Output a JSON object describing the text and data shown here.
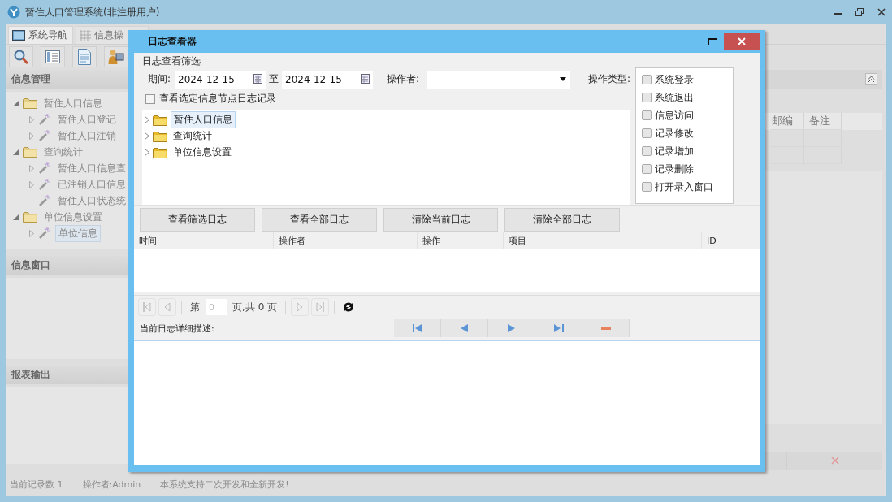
{
  "window": {
    "title": "暂住人口管理系统(非注册用户)"
  },
  "tabs": [
    {
      "label": "系统导航",
      "selected": true
    },
    {
      "label": "信息操",
      "selected": false
    }
  ],
  "sidebar": {
    "sections": [
      {
        "title": "信息管理",
        "tree": [
          {
            "label": "暂住人口信息",
            "expanded": true,
            "selected": false,
            "children": [
              {
                "label": "暂住人口登记",
                "expanded": false,
                "selected": false
              },
              {
                "label": "暂住人口注销",
                "expanded": false,
                "selected": false
              }
            ]
          },
          {
            "label": "查询统计",
            "expanded": true,
            "selected": false,
            "children": [
              {
                "label": "暂住人口信息查",
                "expanded": false,
                "selected": false
              },
              {
                "label": "已注销人口信息",
                "expanded": false,
                "selected": false
              },
              {
                "label": "暂住人口状态统",
                "selected": false
              }
            ]
          },
          {
            "label": "单位信息设置",
            "expanded": true,
            "selected": false,
            "children": [
              {
                "label": "单位信息",
                "expanded": false,
                "selected": true
              }
            ]
          }
        ]
      },
      {
        "title": "信息窗口"
      },
      {
        "title": "报表输出"
      }
    ]
  },
  "main_panel": {
    "columns": [
      "邮编",
      "备注"
    ]
  },
  "dialog": {
    "title": "日志查看器",
    "filter_title": "日志查看筛选",
    "period_label": "期间:",
    "date_from": "2024-12-15",
    "to_label": "至",
    "date_to": "2024-12-15",
    "operator_label": "操作者:",
    "type_label": "操作类型:",
    "types": [
      {
        "label": "系统登录",
        "checked": false
      },
      {
        "label": "系统退出",
        "checked": false
      },
      {
        "label": "信息访问",
        "checked": false
      },
      {
        "label": "记录修改",
        "checked": false
      },
      {
        "label": "记录增加",
        "checked": false
      },
      {
        "label": "记录删除",
        "checked": false
      },
      {
        "label": "打开录入窗口",
        "checked": false
      }
    ],
    "node_filter": {
      "label": "查看选定信息节点日志记录",
      "checked": false
    },
    "tree": [
      {
        "label": "暂住人口信息",
        "expanded": false,
        "selected": true
      },
      {
        "label": "查询统计",
        "expanded": false,
        "selected": false
      },
      {
        "label": "单位信息设置",
        "expanded": false,
        "selected": false
      }
    ],
    "buttons": [
      "查看筛选日志",
      "查看全部日志",
      "清除当前日志",
      "清除全部日志"
    ],
    "columns": [
      "时间",
      "操作者",
      "操作",
      "项目",
      "ID"
    ],
    "pager": {
      "page_prefix": "第",
      "page_value": "0",
      "page_suffix": "页,共 0 页"
    },
    "detail_label": "当前日志详细描述:"
  },
  "status_bar": [
    "当前记录数 1",
    "操作者:Admin",
    "本系统支持二次开发和全新开发!"
  ]
}
